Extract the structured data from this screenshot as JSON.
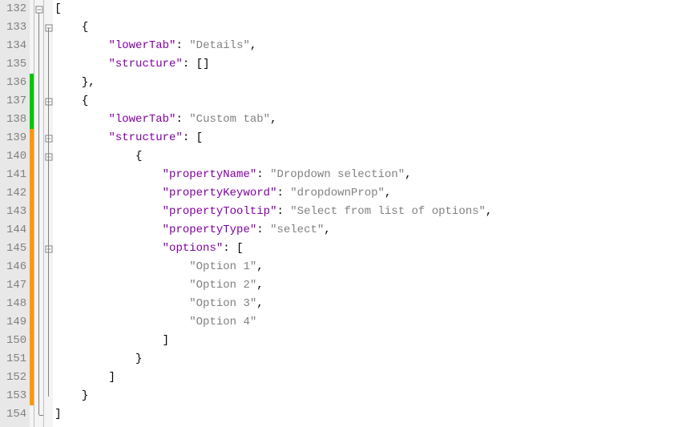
{
  "lines": {
    "start": 132,
    "end": 154,
    "numbers": [
      "132",
      "133",
      "134",
      "135",
      "136",
      "137",
      "138",
      "139",
      "140",
      "141",
      "142",
      "143",
      "144",
      "145",
      "146",
      "147",
      "148",
      "149",
      "150",
      "151",
      "152",
      "153",
      "154"
    ]
  },
  "markers": {
    "green_start": 136,
    "green_end": 138,
    "orange_start": 139,
    "orange_end": 153
  },
  "code": {
    "l132": {
      "indent": "",
      "brace": "["
    },
    "l133": {
      "indent": "    ",
      "brace": "{"
    },
    "l134": {
      "indent": "        ",
      "key": "\"lowerTab\"",
      "sep": ": ",
      "val": "\"Details\"",
      "tail": ","
    },
    "l135": {
      "indent": "        ",
      "key": "\"structure\"",
      "sep": ": ",
      "val": "[]"
    },
    "l136": {
      "indent": "    ",
      "brace": "},"
    },
    "l137": {
      "indent": "    ",
      "brace": "{"
    },
    "l138": {
      "indent": "        ",
      "key": "\"lowerTab\"",
      "sep": ": ",
      "val": "\"Custom tab\"",
      "tail": ","
    },
    "l139": {
      "indent": "        ",
      "key": "\"structure\"",
      "sep": ": ",
      "val": "["
    },
    "l140": {
      "indent": "            ",
      "brace": "{"
    },
    "l141": {
      "indent": "                ",
      "key": "\"propertyName\"",
      "sep": ": ",
      "val": "\"Dropdown selection\"",
      "tail": ","
    },
    "l142": {
      "indent": "                ",
      "key": "\"propertyKeyword\"",
      "sep": ": ",
      "val": "\"dropdownProp\"",
      "tail": ","
    },
    "l143": {
      "indent": "                ",
      "key": "\"propertyTooltip\"",
      "sep": ": ",
      "val": "\"Select from list of options\"",
      "tail": ","
    },
    "l144": {
      "indent": "                ",
      "key": "\"propertyType\"",
      "sep": ": ",
      "val": "\"select\"",
      "tail": ","
    },
    "l145": {
      "indent": "                ",
      "key": "\"options\"",
      "sep": ": ",
      "val": "["
    },
    "l146": {
      "indent": "                    ",
      "val": "\"Option 1\"",
      "tail": ","
    },
    "l147": {
      "indent": "                    ",
      "val": "\"Option 2\"",
      "tail": ","
    },
    "l148": {
      "indent": "                    ",
      "val": "\"Option 3\"",
      "tail": ","
    },
    "l149": {
      "indent": "                    ",
      "val": "\"Option 4\""
    },
    "l150": {
      "indent": "                ",
      "brace": "]"
    },
    "l151": {
      "indent": "            ",
      "brace": "}"
    },
    "l152": {
      "indent": "        ",
      "brace": "]"
    },
    "l153": {
      "indent": "    ",
      "brace": "}"
    },
    "l154": {
      "indent": "",
      "brace": "]"
    }
  },
  "fold_boxes": [
    132,
    133,
    137,
    139,
    140,
    145
  ]
}
